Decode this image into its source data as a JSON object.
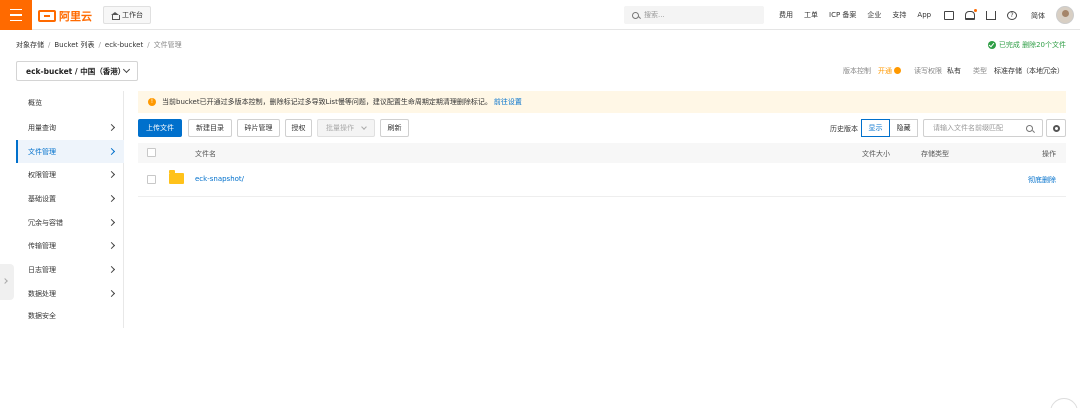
{
  "nav": {
    "brand": "阿里云",
    "workbench": "工作台",
    "search_placeholder": "搜索...",
    "links": [
      "费用",
      "工单",
      "ICP 备案",
      "企业",
      "支持",
      "App"
    ],
    "icons": [
      "mail-icon",
      "bell-icon",
      "cart-icon",
      "help-icon"
    ],
    "lang": "简体"
  },
  "breadcrumb": [
    "对象存储",
    "Bucket 列表",
    "eck-bucket",
    "文件管理"
  ],
  "status": {
    "text": "已完成 删除20个文件",
    "color": "#2e9e45"
  },
  "bucket_selector": "eck-bucket / 中国（香港）",
  "bucket_meta": {
    "version_label": "版本控制",
    "version_value": "开通",
    "acl_label": "读写权限",
    "acl_value": "私有",
    "type_label": "类型",
    "type_value": "标准存储（本地冗余）"
  },
  "sidebar": {
    "items": [
      {
        "label": "概览"
      },
      {
        "label": "用量查询"
      },
      {
        "label": "文件管理"
      },
      {
        "label": "权限管理"
      },
      {
        "label": "基础设置"
      },
      {
        "label": "冗余与容错"
      },
      {
        "label": "传输管理"
      },
      {
        "label": "日志管理"
      },
      {
        "label": "数据处理"
      },
      {
        "label": "数据安全"
      }
    ],
    "active_index": 2
  },
  "notice": {
    "text": "当前bucket已开通过多版本控制，删除标记过多导致List慢等问题，建议配置生命周期定期清理删除标记。",
    "link": "前往设置"
  },
  "toolbar": {
    "upload": "上传文件",
    "new_dir": "新建目录",
    "fragments": "碎片管理",
    "authorize": "授权",
    "batch": "批量操作",
    "refresh": "刷新",
    "history_label": "历史版本",
    "show": "显示",
    "hide": "隐藏",
    "search_placeholder": "请输入文件名前缀匹配"
  },
  "table": {
    "headers": {
      "name": "文件名",
      "size": "文件大小",
      "storage": "存储类型",
      "action": "操作"
    },
    "rows": [
      {
        "name": "eck-snapshot/",
        "size": "",
        "storage": "",
        "action": "彻底删除"
      }
    ]
  },
  "colors": {
    "brand": "#ff6a00",
    "primary": "#0070cc",
    "warn": "#ff9900"
  }
}
